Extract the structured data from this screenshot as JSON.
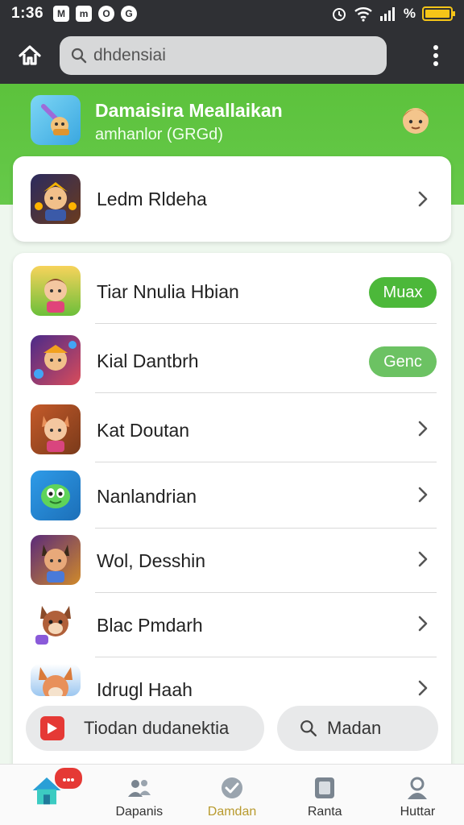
{
  "status_bar": {
    "time": "1:36",
    "notifications": [
      "M",
      "m",
      "O",
      "G"
    ],
    "percent": "%",
    "battery_level": 1.0
  },
  "app_bar": {
    "search_text": "dhdensiai"
  },
  "header": {
    "title": "Damaisira Meallaikan",
    "subtitle": "amhanlor (GRGd)"
  },
  "featured": {
    "label": "Ledm Rldeha"
  },
  "list": {
    "items": [
      {
        "label": "Tiar Nnulia Hbian",
        "action": "pill",
        "pill_label": "Muax",
        "pill_color": "#4cb83a"
      },
      {
        "label": "Kial Dantbrh",
        "action": "pill",
        "pill_label": "Genc",
        "pill_color": "#6cc263"
      },
      {
        "label": "Kat Doutan",
        "action": "chevron"
      },
      {
        "label": "Nanlandrian",
        "action": "chevron"
      },
      {
        "label": "Wol, Desshin",
        "action": "chevron"
      },
      {
        "label": "Blac Pmdarh",
        "action": "chevron"
      },
      {
        "label": "Idrugl Haah",
        "action": "chevron"
      }
    ],
    "bottom_left_label": "Tiodan dudanektia",
    "bottom_right_label": "Madan"
  },
  "bottom_nav": {
    "items": [
      {
        "label": ""
      },
      {
        "label": "Dapanis"
      },
      {
        "label": "Damdan"
      },
      {
        "label": "Ranta"
      },
      {
        "label": "Huttar"
      }
    ],
    "active_color": "#b89a2e"
  },
  "colors": {
    "accent_green": "#5cc23c",
    "dark_bar": "#2f3034"
  }
}
